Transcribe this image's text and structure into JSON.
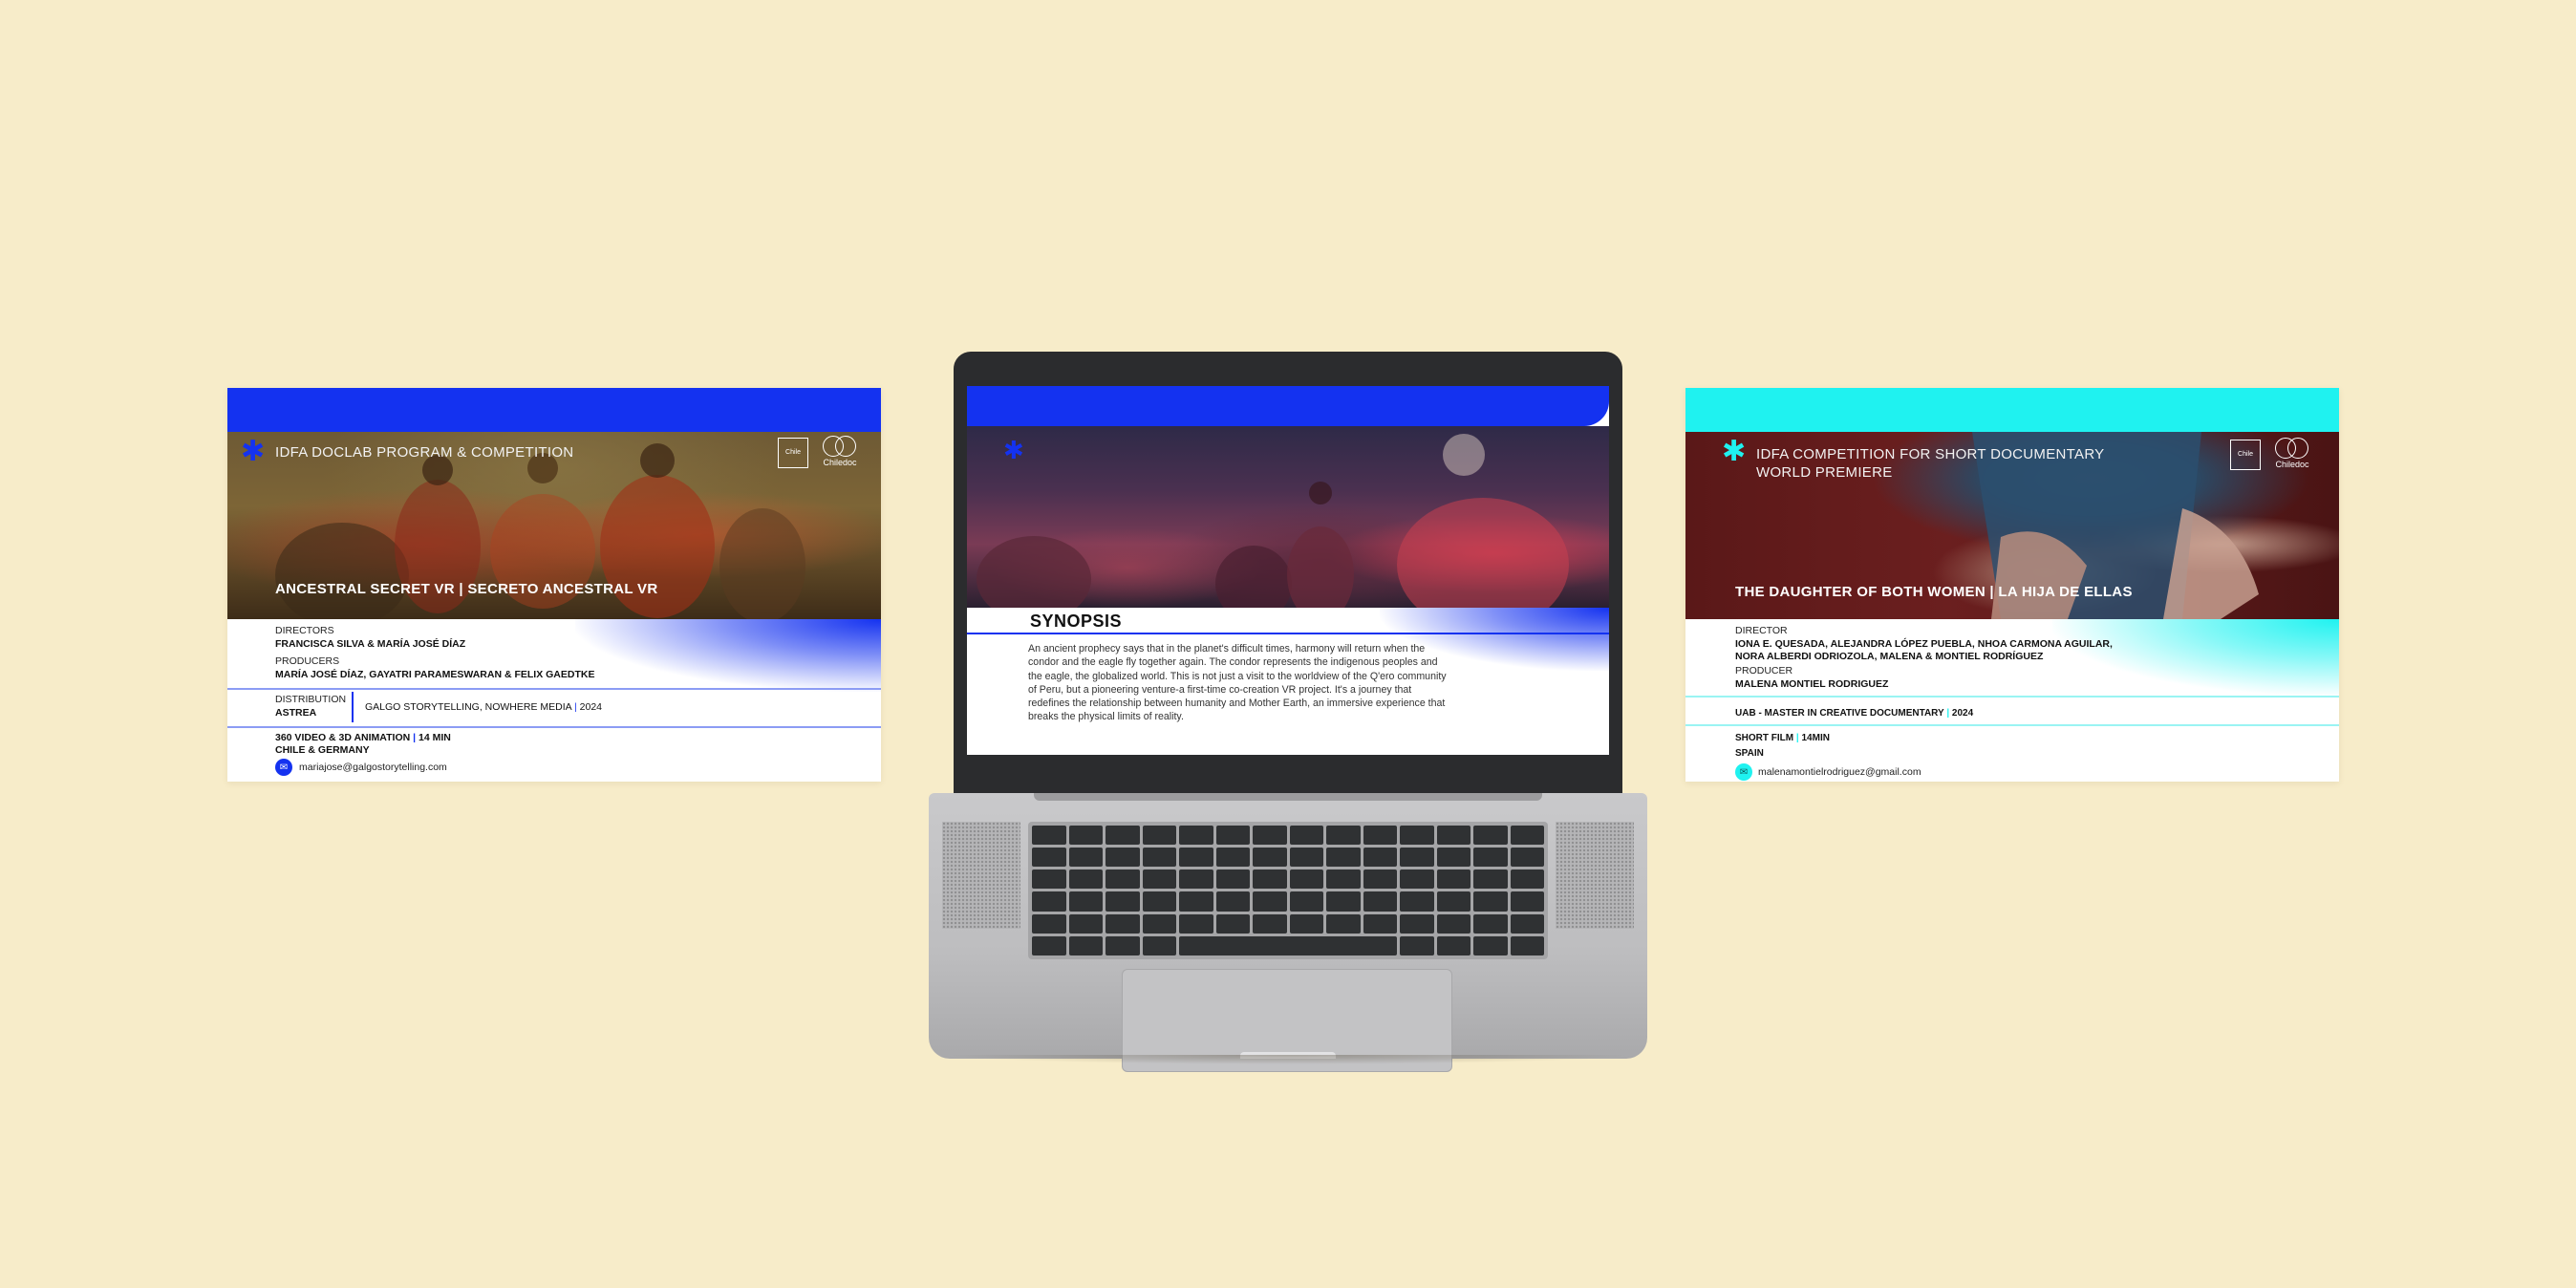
{
  "cards": {
    "left": {
      "program": "IDFA DOCLAB PROGRAM & COMPETITION",
      "logo1": "Chile",
      "logo2": "Chiledoc",
      "film_title": "ANCESTRAL SECRET VR | SECRETO ANCESTRAL VR",
      "directors_label": "DIRECTORS",
      "directors": "FRANCISCA SILVA & MARÍA JOSÉ DÍAZ",
      "producers_label": "PRODUCERS",
      "producers": "MARÍA JOSÉ DÍAZ, GAYATRI PARAMESWARAN & FELIX GAEDTKE",
      "distribution_label": "DISTRIBUTION",
      "distribution": "ASTREA",
      "companies": "GALGO STORYTELLING, NOWHERE MEDIA",
      "year": "2024",
      "format": "360 VIDEO & 3D ANIMATION",
      "duration": "14 MIN",
      "country": "CHILE & GERMANY",
      "email": "mariajose@galgostorytelling.com",
      "accent": "#1432f0"
    },
    "right": {
      "program_line1": "IDFA COMPETITION FOR SHORT DOCUMENTARY",
      "program_line2": "WORLD PREMIERE",
      "logo1": "Chile",
      "logo2": "Chiledoc",
      "film_title": "THE DAUGHTER OF BOTH WOMEN |  LA HIJA DE ELLAS",
      "director_label": "DIRECTOR",
      "director_line1": "IONA E. QUESADA, ALEJANDRA LÓPEZ PUEBLA, NHOA CARMONA AGUILAR,",
      "director_line2": "NORA ALBERDI ODRIOZOLA, MALENA & MONTIEL RODRÍGUEZ",
      "producer_label": "PRODUCER",
      "producer": "MALENA MONTIEL RODRIGUEZ",
      "school": "UAB - MASTER IN CREATIVE DOCUMENTARY",
      "year": "2024",
      "format": "SHORT FILM",
      "duration": "14MIN",
      "country": "SPAIN",
      "email": "malenamontielrodriguez@gmail.com",
      "accent": "#1ff2f0"
    }
  },
  "laptop": {
    "synopsis_title": "SYNOPSIS",
    "synopsis_text": "An ancient prophecy says that in the planet's difficult times, harmony will return when the condor and the eagle fly together again. The condor represents the indigenous peoples and the eagle, the globalized world. This is not just a visit to the worldview of the Q'ero community of Peru, but a pioneering venture-a first-time co-creation VR project. It's a journey that redefines the relationship between humanity and Mother Earth, an immersive experience that breaks the physical limits of reality.",
    "accent": "#1432f0"
  },
  "icons": {
    "star": "asterisk-star-icon",
    "email": "email-icon"
  }
}
